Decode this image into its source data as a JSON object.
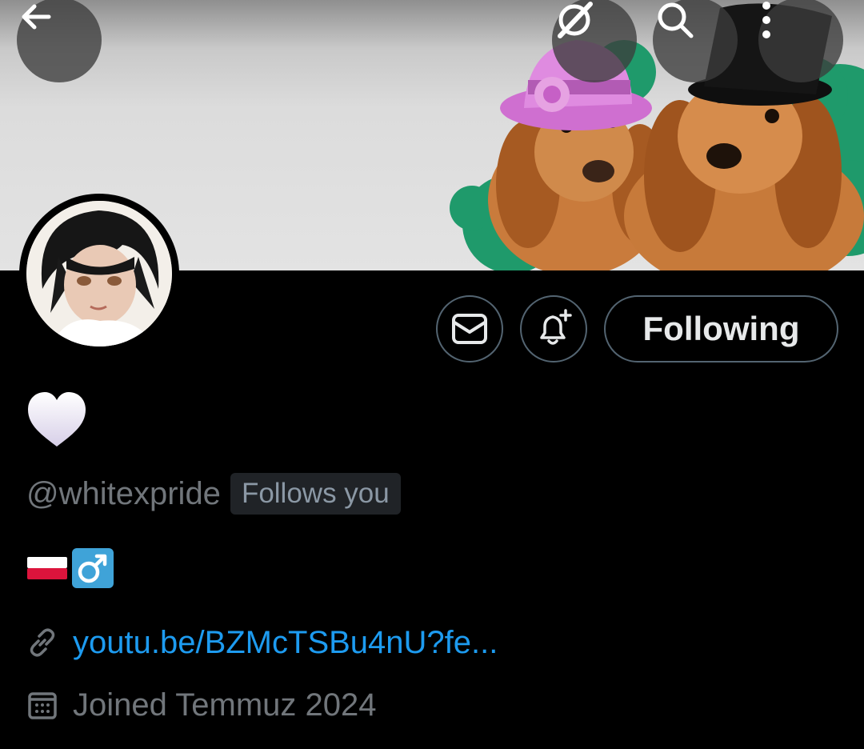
{
  "header": {
    "back_icon": "arrow-left-icon",
    "grok_icon": "grok-icon",
    "search_icon": "search-icon",
    "more_icon": "more-vertical-icon"
  },
  "banner": {
    "description_colors": {
      "shamrock": "#1e9b6a",
      "hat_pink": "#d97ad8",
      "hat_black": "#141414"
    }
  },
  "actions": {
    "message_icon": "mail-icon",
    "notify_icon": "bell-plus-icon",
    "following_label": "Following"
  },
  "profile": {
    "display_name": "🤍",
    "handle": "@whitexpride",
    "follows_you": "Follows you",
    "bio": "🇵🇱♂️",
    "link": "youtu.be/BZMcTSBu4nU?fe...",
    "joined": "Joined Temmuz 2024"
  },
  "colors": {
    "background": "#000000",
    "text_primary": "#e7e9ea",
    "text_secondary": "#71767b",
    "link": "#1d9bf0",
    "border": "#536471",
    "badge_bg": "#202327"
  }
}
